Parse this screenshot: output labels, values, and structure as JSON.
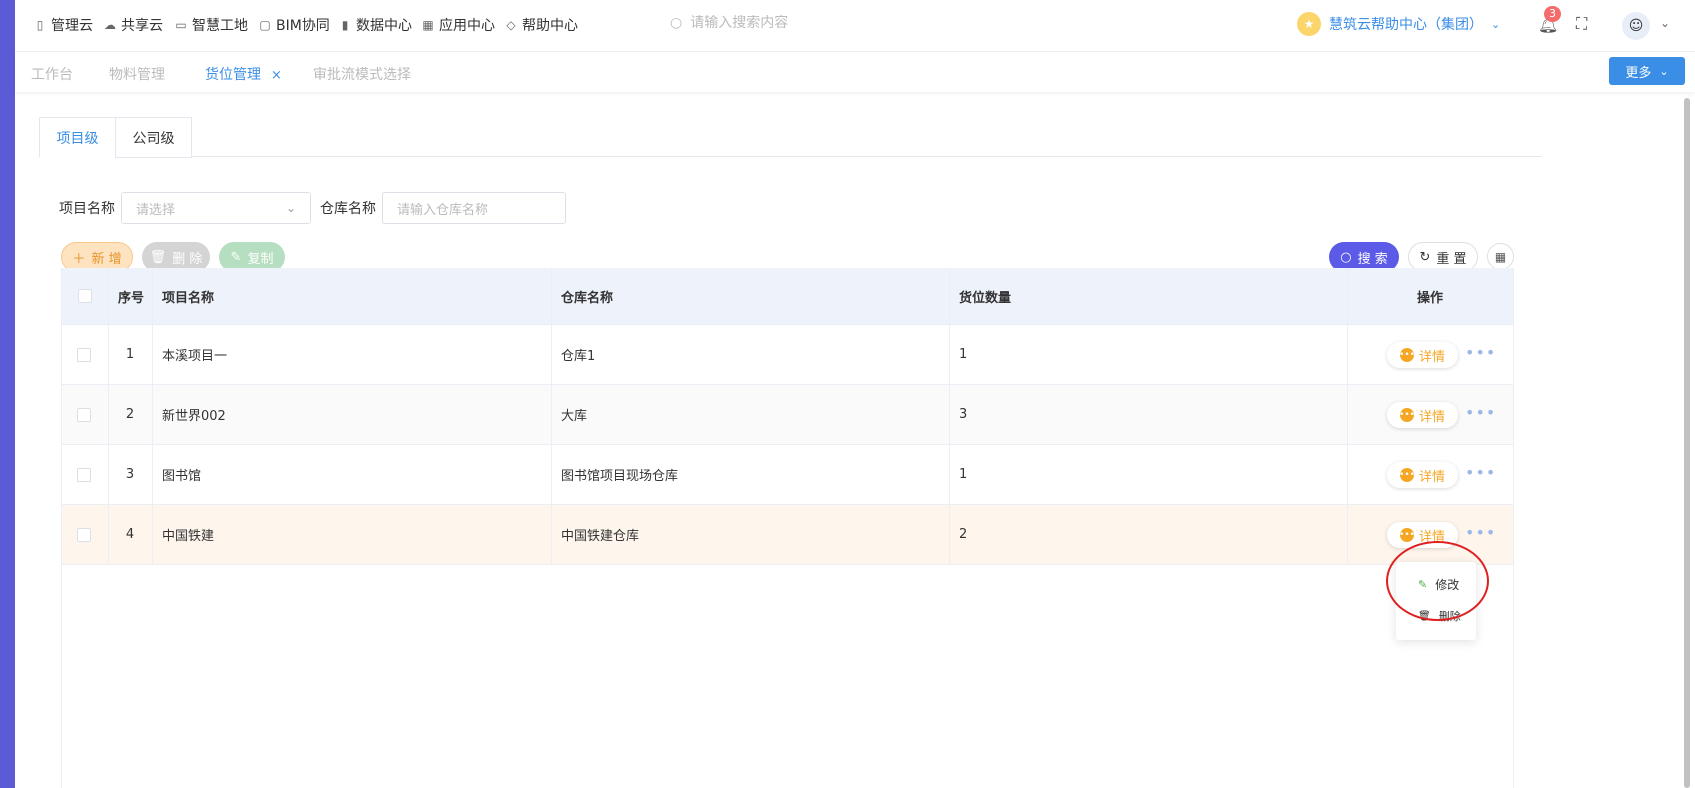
{
  "nav": {
    "items": [
      {
        "icon": "book-icon",
        "label": "管理云"
      },
      {
        "icon": "cloud-icon",
        "label": "共享云"
      },
      {
        "icon": "building-icon",
        "label": "智慧工地"
      },
      {
        "icon": "cube-icon",
        "label": "BIM协同"
      },
      {
        "icon": "bar-chart-icon",
        "label": "数据中心"
      },
      {
        "icon": "grid-icon",
        "label": "应用中心"
      },
      {
        "icon": "diamond-icon",
        "label": "帮助中心"
      }
    ],
    "search_placeholder": "请输入搜索内容",
    "org_name": "慧筑云帮助中心（集团）",
    "notification_count": "3"
  },
  "tabs": {
    "items": [
      "工作台",
      "物料管理",
      "货位管理",
      "审批流模式选择"
    ],
    "active_index": 2,
    "close_glyph": "×",
    "more_label": "更多"
  },
  "level_tabs": [
    "项目级",
    "公司级"
  ],
  "filters": {
    "project_label": "项目名称",
    "project_placeholder": "请选择",
    "warehouse_label": "仓库名称",
    "warehouse_placeholder": "请输入仓库名称"
  },
  "toolbar": {
    "add_label": "新 增",
    "delete_label": "删 除",
    "copy_label": "复制",
    "search_label": "搜 索",
    "reset_label": "重 置"
  },
  "table": {
    "headers": [
      "序号",
      "项目名称",
      "仓库名称",
      "货位数量",
      "操作"
    ],
    "rows": [
      {
        "no": "1",
        "project": "本溪项目一",
        "warehouse": "仓库1",
        "count": "1"
      },
      {
        "no": "2",
        "project": "新世界002",
        "warehouse": "大库",
        "count": "3"
      },
      {
        "no": "3",
        "project": "图书馆",
        "warehouse": "图书馆项目现场仓库",
        "count": "1"
      },
      {
        "no": "4",
        "project": "中国铁建",
        "warehouse": "中国铁建仓库",
        "count": "2"
      }
    ],
    "detail_label": "详情"
  },
  "row_menu": {
    "edit_label": "修改",
    "delete_label": "删除"
  },
  "colors": {
    "primary": "#3a8ee6",
    "accent_purple": "#5b5be8",
    "orange": "#f5a623",
    "highlight_row": "#fef5ec",
    "annotation_red": "#e02020"
  }
}
